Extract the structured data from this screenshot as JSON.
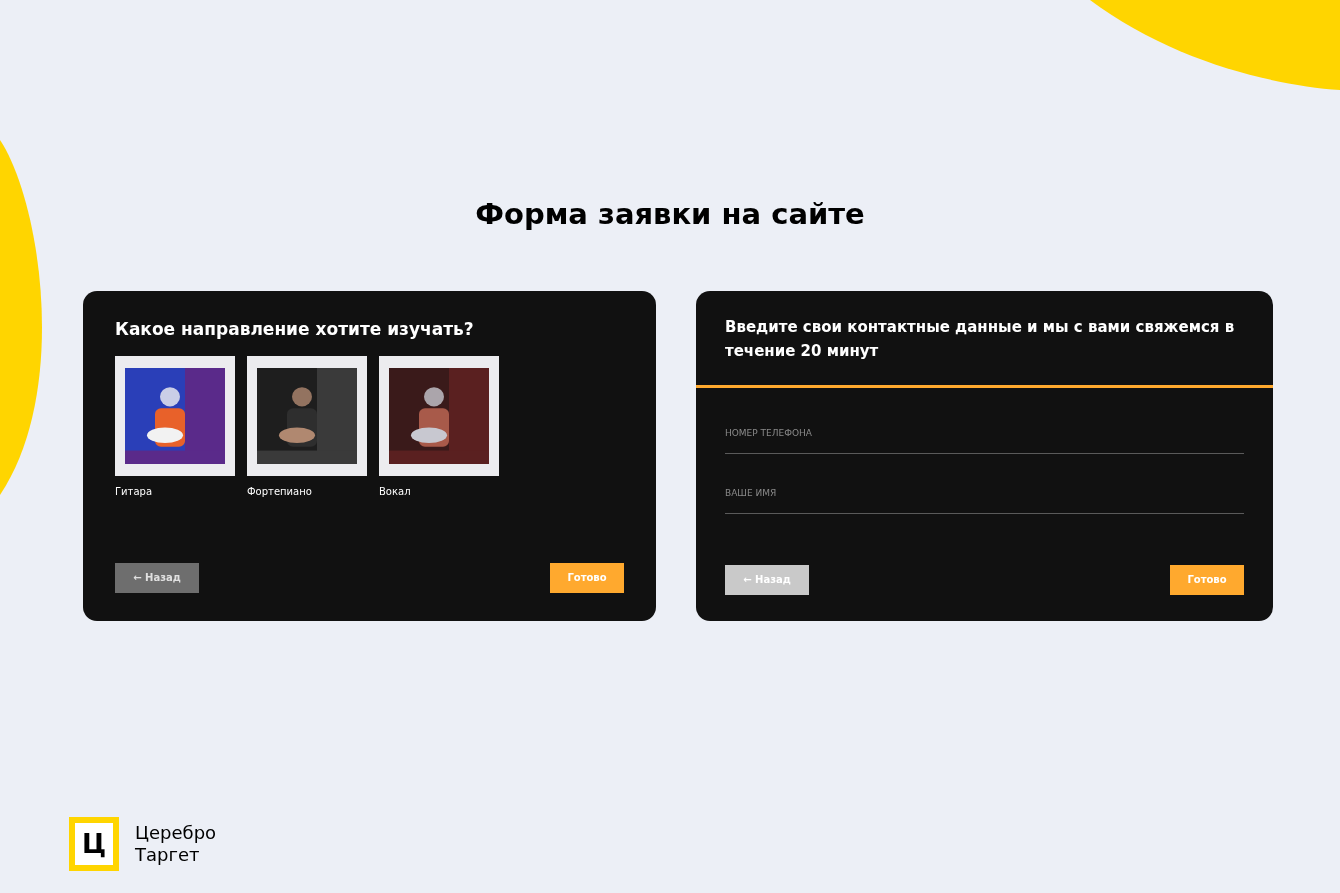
{
  "heading": "Форма заявки на сайте",
  "step_card": {
    "question": "Какое направление хотите изучать?",
    "options": [
      {
        "label": "Гитара",
        "kind": "picture"
      },
      {
        "label": "Фортепиано",
        "kind": "picture"
      },
      {
        "label": "Вокал",
        "kind": "picture"
      }
    ],
    "back_button": {
      "label": "← Назад",
      "disabled": true
    },
    "done_button": {
      "label": "Готово"
    }
  },
  "contact_card": {
    "title": "Введите свои контактные данные и мы с вами свяжемся в течение 20 минут",
    "fields": [
      {
        "placeholder": "НОМЕР ТЕЛЕФОНА"
      },
      {
        "placeholder": "ВАШЕ ИМЯ"
      }
    ],
    "back_button": {
      "label": "← Назад",
      "disabled": false
    },
    "done_button": {
      "label": "Готово"
    }
  },
  "logo": {
    "mark": "Ц",
    "lines": [
      "Церебро",
      "Таргет"
    ]
  }
}
